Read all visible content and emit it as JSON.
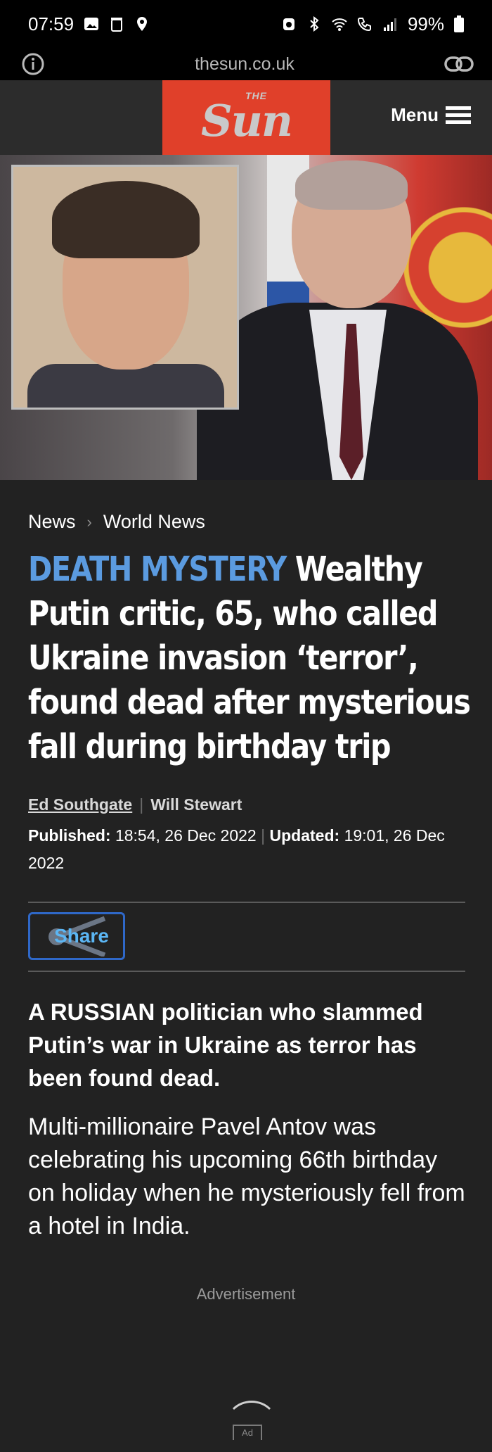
{
  "status_bar": {
    "time": "07:59",
    "battery": "99%"
  },
  "browser": {
    "url": "thesun.co.uk"
  },
  "site_header": {
    "logo_small": "THE",
    "logo_big": "Sun",
    "menu_label": "Menu"
  },
  "breadcrumb": {
    "items": [
      "News",
      "World News"
    ]
  },
  "article": {
    "kicker": "DEATH MYSTERY",
    "headline": "Wealthy Putin critic, 65, who called Ukraine invasion ‘terror’, found dead after mysterious fall during birthday trip",
    "authors": [
      "Ed Southgate",
      "Will Stewart"
    ],
    "published_label": "Published:",
    "published_value": "18:54, 26 Dec 2022",
    "updated_label": "Updated:",
    "updated_value": "19:01, 26 Dec 2022",
    "share_label": "Share",
    "standfirst": "A RUSSIAN politician who slammed Putin’s war in Ukraine as terror has been found dead.",
    "body": "Multi-millionaire Pavel Antov was celebrating his upcoming 66th birthday on holiday when he mysteriously fell from a hotel in India."
  },
  "ad": {
    "label": "Advertisement",
    "badge": "Ad"
  },
  "colors": {
    "brand_red": "#e0402a",
    "kicker_blue": "#5b9be0",
    "share_border": "#2f68c8"
  }
}
